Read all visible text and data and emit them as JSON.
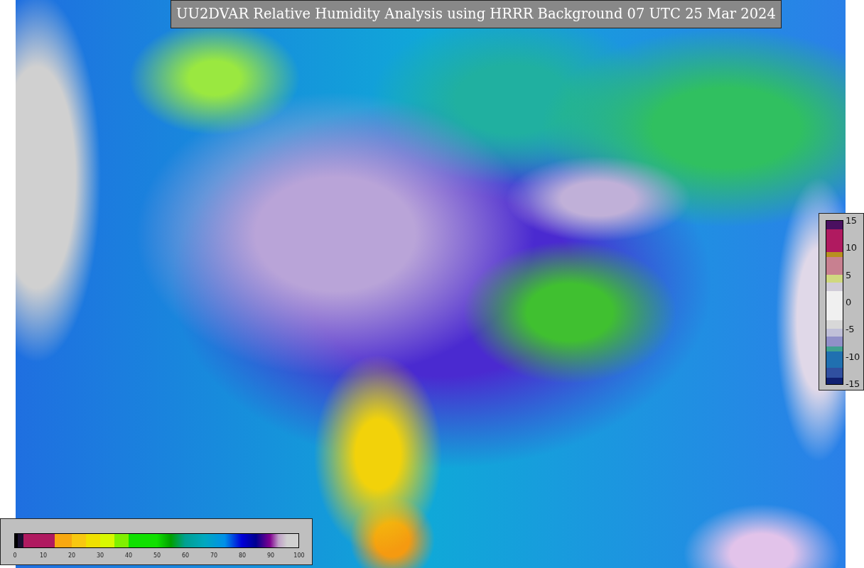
{
  "title": "UU2DVAR Relative Humidity Analysis using HRRR Background 07 UTC 25 Mar 2024",
  "humidity_colorbar": {
    "ticks": [
      "0",
      "10",
      "20",
      "30",
      "40",
      "50",
      "60",
      "70",
      "80",
      "90",
      "100"
    ]
  },
  "difference_colorbar": {
    "ticks": [
      "15",
      "10",
      "5",
      "0",
      "-5",
      "-10",
      "-15"
    ]
  }
}
